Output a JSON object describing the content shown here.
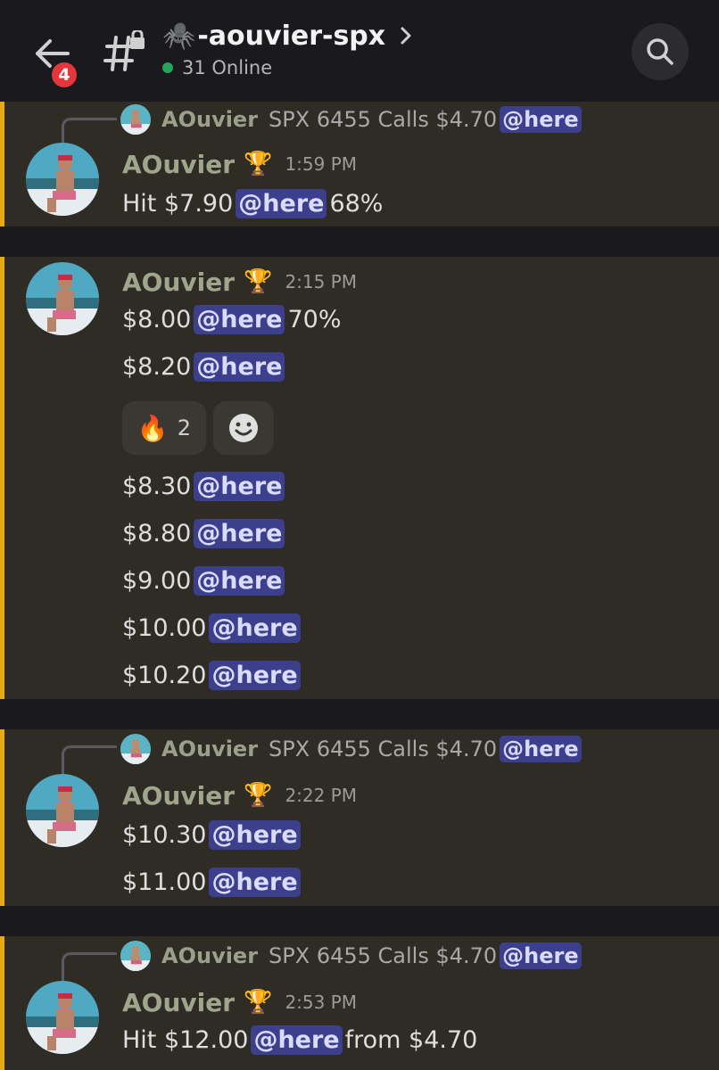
{
  "header": {
    "badge_count": "4",
    "channel_name": "-aouvier-spx",
    "online_text": "31 Online"
  },
  "blocks": [
    {
      "reply": {
        "name": "AOuvier",
        "text": "SPX 6455 Calls $4.70",
        "mention": "@here"
      },
      "author": "AOuvier",
      "time": "1:59 PM",
      "lines": [
        {
          "pre": "Hit $7.90",
          "mention": "@here",
          "post": "68%"
        }
      ]
    },
    {
      "author": "AOuvier",
      "time": "2:15 PM",
      "lines": [
        {
          "pre": "$8.00",
          "mention": "@here",
          "post": "70%"
        },
        {
          "pre": "$8.20",
          "mention": "@here",
          "post": ""
        },
        {
          "pre": "$8.30",
          "mention": "@here",
          "post": ""
        },
        {
          "pre": "$8.80",
          "mention": "@here",
          "post": ""
        },
        {
          "pre": "$9.00",
          "mention": "@here",
          "post": ""
        },
        {
          "pre": "$10.00",
          "mention": "@here",
          "post": ""
        },
        {
          "pre": "$10.20",
          "mention": "@here",
          "post": ""
        }
      ],
      "reactions": [
        {
          "emoji": "🔥",
          "count": "2"
        },
        {
          "emoji": "add-reaction-icon",
          "count": ""
        }
      ]
    },
    {
      "reply": {
        "name": "AOuvier",
        "text": "SPX 6455 Calls $4.70",
        "mention": "@here"
      },
      "author": "AOuvier",
      "time": "2:22 PM",
      "lines": [
        {
          "pre": "$10.30",
          "mention": "@here",
          "post": ""
        },
        {
          "pre": "$11.00",
          "mention": "@here",
          "post": ""
        }
      ]
    },
    {
      "reply": {
        "name": "AOuvier",
        "text": "SPX 6455 Calls $4.70",
        "mention": "@here"
      },
      "author": "AOuvier",
      "time": "2:53 PM",
      "lines": [
        {
          "pre": "Hit $12.00",
          "mention": "@here",
          "post": "from $4.70"
        }
      ]
    }
  ],
  "colors": {
    "accent_bar": "#e8a911",
    "mention_bg": "#3c3f8c",
    "online": "#23a55a",
    "badge": "#e5353d"
  }
}
